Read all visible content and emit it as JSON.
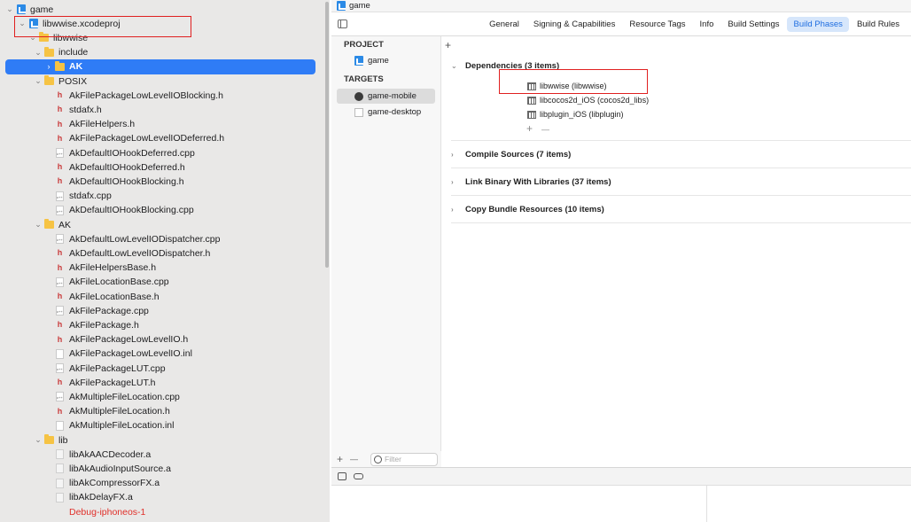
{
  "navigator": {
    "rows": [
      {
        "label": "game",
        "icon": "project-icon",
        "chev": "⌄",
        "indent": 6
      },
      {
        "label": "libwwise.xcodeproj",
        "icon": "project-icon",
        "chev": "⌄",
        "indent": 20
      },
      {
        "label": "libwwise",
        "icon": "folder-icon",
        "chev": "⌄",
        "indent": 32
      },
      {
        "label": "include",
        "icon": "folder-icon",
        "chev": "⌄",
        "indent": 38
      },
      {
        "label": "AK",
        "icon": "folder-icon",
        "chev": "›",
        "indent": 50,
        "selected": true
      },
      {
        "label": "POSIX",
        "icon": "folder-icon",
        "chev": "⌄",
        "indent": 38
      },
      {
        "label": "AkFilePackageLowLevelIOBlocking.h",
        "icon": "header-file-icon",
        "indent": 62
      },
      {
        "label": "stdafx.h",
        "icon": "header-file-icon",
        "indent": 62
      },
      {
        "label": "AkFileHelpers.h",
        "icon": "header-file-icon",
        "indent": 62
      },
      {
        "label": "AkFilePackageLowLevelIODeferred.h",
        "icon": "header-file-icon",
        "indent": 62
      },
      {
        "label": "AkDefaultIOHookDeferred.cpp",
        "icon": "cpp-file-icon",
        "indent": 62
      },
      {
        "label": "AkDefaultIOHookDeferred.h",
        "icon": "header-file-icon",
        "indent": 62
      },
      {
        "label": "AkDefaultIOHookBlocking.h",
        "icon": "header-file-icon",
        "indent": 62
      },
      {
        "label": "stdafx.cpp",
        "icon": "cpp-file-icon",
        "indent": 62
      },
      {
        "label": "AkDefaultIOHookBlocking.cpp",
        "icon": "cpp-file-icon",
        "indent": 62
      },
      {
        "label": "AK",
        "icon": "folder-icon",
        "chev": "⌄",
        "indent": 38
      },
      {
        "label": "AkDefaultLowLevelIODispatcher.cpp",
        "icon": "cpp-file-icon",
        "indent": 62
      },
      {
        "label": "AkDefaultLowLevelIODispatcher.h",
        "icon": "header-file-icon",
        "indent": 62
      },
      {
        "label": "AkFileHelpersBase.h",
        "icon": "header-file-icon",
        "indent": 62
      },
      {
        "label": "AkFileLocationBase.cpp",
        "icon": "cpp-file-icon",
        "indent": 62
      },
      {
        "label": "AkFileLocationBase.h",
        "icon": "header-file-icon",
        "indent": 62
      },
      {
        "label": "AkFilePackage.cpp",
        "icon": "cpp-file-icon",
        "indent": 62
      },
      {
        "label": "AkFilePackage.h",
        "icon": "header-file-icon",
        "indent": 62
      },
      {
        "label": "AkFilePackageLowLevelIO.h",
        "icon": "header-file-icon",
        "indent": 62
      },
      {
        "label": "AkFilePackageLowLevelIO.inl",
        "icon": "inl-file-icon",
        "indent": 62
      },
      {
        "label": "AkFilePackageLUT.cpp",
        "icon": "cpp-file-icon",
        "indent": 62
      },
      {
        "label": "AkFilePackageLUT.h",
        "icon": "header-file-icon",
        "indent": 62
      },
      {
        "label": "AkMultipleFileLocation.cpp",
        "icon": "cpp-file-icon",
        "indent": 62
      },
      {
        "label": "AkMultipleFileLocation.h",
        "icon": "header-file-icon",
        "indent": 62
      },
      {
        "label": "AkMultipleFileLocation.inl",
        "icon": "inl-file-icon",
        "indent": 62
      },
      {
        "label": "lib",
        "icon": "folder-icon",
        "chev": "⌄",
        "indent": 38
      },
      {
        "label": "libAkAACDecoder.a",
        "icon": "library-file-icon",
        "indent": 62
      },
      {
        "label": "libAkAudioInputSource.a",
        "icon": "library-file-icon",
        "indent": 62
      },
      {
        "label": "libAkCompressorFX.a",
        "icon": "library-file-icon",
        "indent": 62
      },
      {
        "label": "libAkDelayFX.a",
        "icon": "library-file-icon",
        "indent": 62
      },
      {
        "label": "Debug-iphoneos-1",
        "icon": "none",
        "indent": 62,
        "red": true
      }
    ]
  },
  "titlebar": {
    "project": "game"
  },
  "tabs": [
    "General",
    "Signing & Capabilities",
    "Resource Tags",
    "Info",
    "Build Settings",
    "Build Phases",
    "Build Rules"
  ],
  "active_tab": "Build Phases",
  "targets_pane": {
    "project_heading": "PROJECT",
    "project_item": "game",
    "targets_heading": "TARGETS",
    "targets": [
      "game-mobile",
      "game-desktop"
    ],
    "filter_placeholder": "Filter",
    "add": "+",
    "remove": "—"
  },
  "phases": {
    "add": "+",
    "dependencies_title": "Dependencies (3 items)",
    "dependencies": [
      "libwwise (libwwise)",
      "libcocos2d_iOS (cocos2d_libs)",
      "libplugin_iOS (libplugin)"
    ],
    "dep_add": "+",
    "dep_remove": "—",
    "compile_sources": "Compile Sources (7 items)",
    "link_binary": "Link Binary With Libraries (37 items)",
    "copy_bundle": "Copy Bundle Resources (10 items)"
  },
  "colors": {
    "accent": "#2f7cf6",
    "highlight_box": "#e02020",
    "folder": "#f6c344"
  }
}
